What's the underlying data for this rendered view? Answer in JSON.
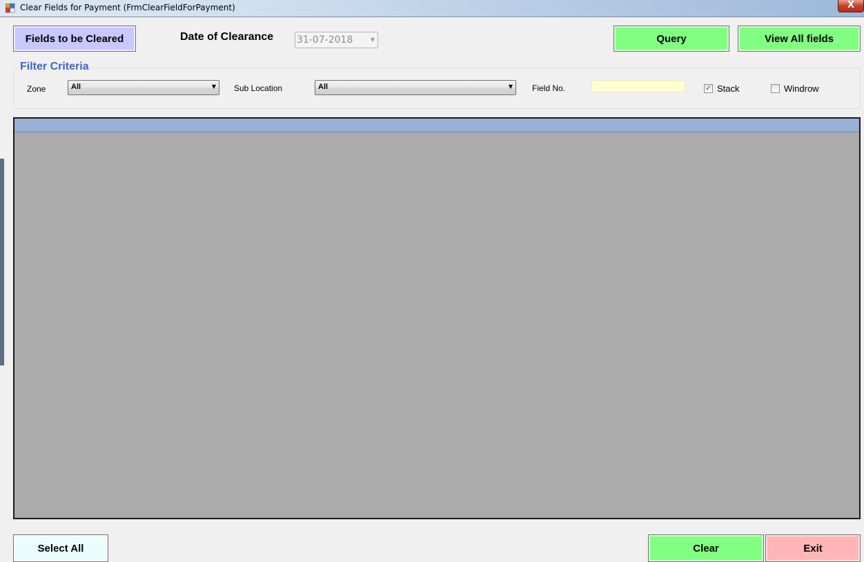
{
  "window": {
    "title": "Clear Fields for Payment (FrmClearFieldForPayment)",
    "close_label": "X"
  },
  "header": {
    "fields_button": "Fields to be Cleared",
    "date_label": "Date of Clearance",
    "date_value": "31-07-2018",
    "query_button": "Query",
    "view_all_button": "View All fields"
  },
  "filter": {
    "legend": "Filter Criteria",
    "zone_label": "Zone",
    "zone_value": "All",
    "sub_location_label": "Sub Location",
    "sub_location_value": "All",
    "field_no_label": "Field No.",
    "field_no_value": "",
    "stack_label": "Stack",
    "stack_checked": true,
    "windrow_label": "Windrow",
    "windrow_checked": false
  },
  "footer": {
    "select_all_button": "Select All",
    "clear_button": "Clear",
    "exit_button": "Exit"
  },
  "colors": {
    "query_button": "#80ff80",
    "fields_button": "#c8c8ff",
    "exit_button": "#ffb6b6",
    "grid_background": "#ababab",
    "grid_header": "#97b0d4",
    "field_no_input": "#ffffd0",
    "legend_text": "#3c64c8"
  }
}
